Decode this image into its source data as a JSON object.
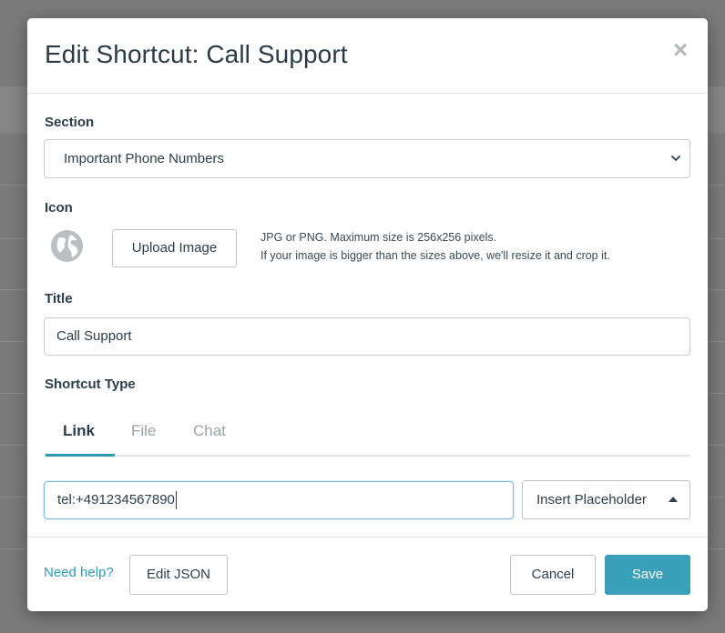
{
  "modal": {
    "title": "Edit Shortcut: Call Support",
    "close_glyph": "×"
  },
  "section": {
    "label": "Section",
    "selected": "Important Phone Numbers"
  },
  "icon": {
    "label": "Icon",
    "current_icon": "globe-icon",
    "upload_label": "Upload Image",
    "help_line1": "JPG or PNG. Maximum size is 256x256 pixels.",
    "help_line2": "If your image is bigger than the sizes above, we'll resize it and crop it."
  },
  "title_field": {
    "label": "Title",
    "value": "Call Support"
  },
  "shortcut_type": {
    "label": "Shortcut Type",
    "tabs": [
      {
        "label": "Link",
        "active": true
      },
      {
        "label": "File",
        "active": false
      },
      {
        "label": "Chat",
        "active": false
      }
    ]
  },
  "link": {
    "value": "tel:+491234567890",
    "insert_placeholder_label": "Insert Placeholder"
  },
  "footer": {
    "help_link": "Need help?",
    "edit_json_label": "Edit JSON",
    "cancel_label": "Cancel",
    "save_label": "Save"
  },
  "colors": {
    "accent": "#3a9fb8",
    "link": "#2e9bb6",
    "overlay": "#7a7a7a"
  }
}
